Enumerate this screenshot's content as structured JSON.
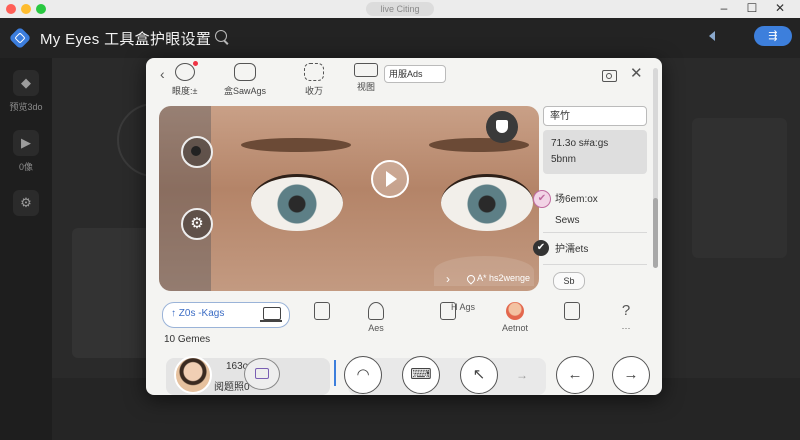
{
  "window": {
    "title": "live Citing"
  },
  "app": {
    "title": "My Eyes 工具盒护眼设置",
    "header_button": "⇶"
  },
  "rail": [
    {
      "label": "预览3do",
      "icon": "eye-mode-icon"
    },
    {
      "label": "0像",
      "icon": "play-icon"
    },
    {
      "label": "",
      "icon": "settings-icon"
    }
  ],
  "dialog": {
    "toolbar": [
      {
        "label": "眼度:±",
        "icon": "chat-bubble-icon"
      },
      {
        "label": "盒SawAgs",
        "icon": "speech-icon"
      },
      {
        "label": "收万",
        "icon": "frame-icon"
      },
      {
        "label": "视图",
        "icon": "keyboard-icon"
      }
    ],
    "search_value": "用服Ads",
    "preview": {
      "location_label": "A* hs2wenge"
    },
    "side_panel": {
      "input_value": "率竹",
      "card_line1": "71.3o s#a:gs",
      "card_line2": "5bnm",
      "row1_title": "场6em:ox",
      "row1_sub": "Sews",
      "row2_title": "护濡ets",
      "button_label": "Sb"
    },
    "tools": {
      "active_tab": "↑ Z0s -Kags",
      "items": [
        {
          "label": "",
          "icon": "document-dollar-icon"
        },
        {
          "label": "Aes",
          "icon": "plant-icon"
        },
        {
          "label": "H Ags",
          "icon": "calendar-check-icon"
        },
        {
          "label": "Aetnot",
          "icon": "avatar-sticker-icon"
        },
        {
          "label": "",
          "icon": "grid-doc-icon"
        },
        {
          "label": "···",
          "icon": "help-icon"
        }
      ],
      "count": "10 Gemes"
    },
    "bottom": {
      "user_line1": "163o",
      "user_line2": "阅题照0",
      "buttons": [
        "wifi-icon",
        "keyboard-icon",
        "pointer-icon",
        "back-icon",
        "forward-icon"
      ]
    }
  },
  "colors": {
    "accent": "#3d7fdc",
    "dialog_bg": "#f4f4f2",
    "backdrop": "#2a2a2a"
  }
}
